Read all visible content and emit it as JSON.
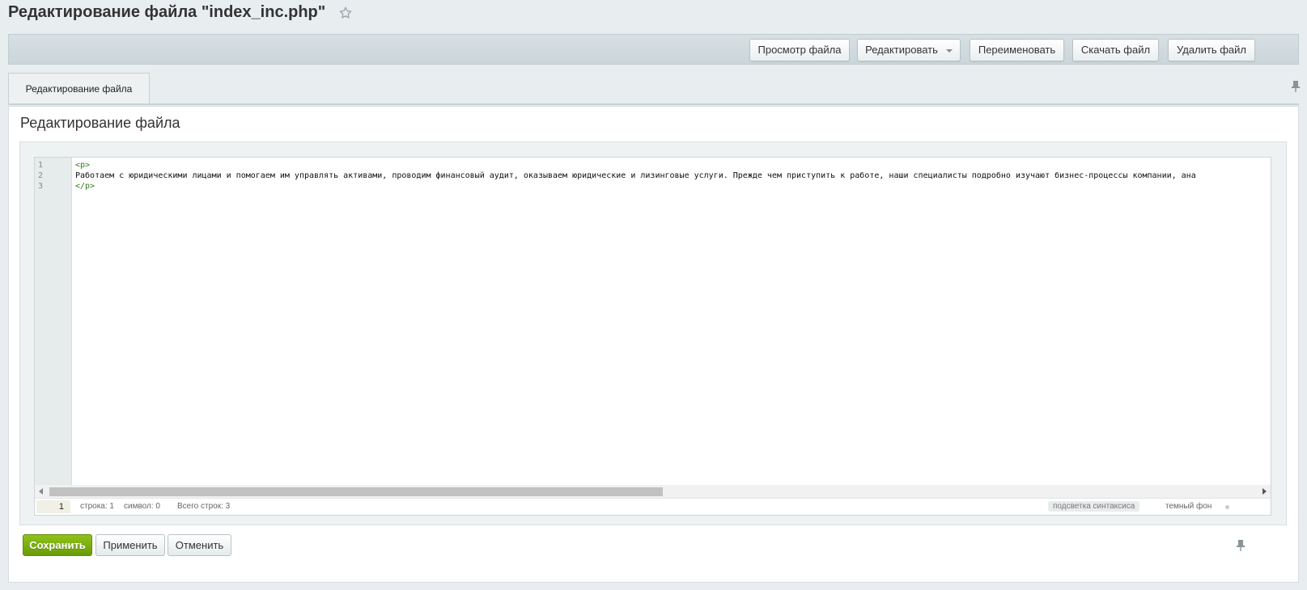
{
  "header": {
    "title": "Редактирование файла \"index_inc.php\""
  },
  "toolbar": {
    "view_label": "Просмотр файла",
    "edit_label": "Редактировать",
    "rename_label": "Переименовать",
    "download_label": "Скачать файл",
    "delete_label": "Удалить файл"
  },
  "tabs": [
    {
      "label": "Редактирование файла"
    }
  ],
  "main": {
    "section_title": "Редактирование файла"
  },
  "editor": {
    "line_numbers": [
      "1",
      "2",
      "3"
    ],
    "lines": [
      "<p>",
      "Работаем с юридическими лицами и помогаем им управлять активами, проводим финансовый аудит, оказываем юридические и лизинговые услуги. Прежде чем приступить к работе, наши специалисты подробно изучают бизнес-процессы компании, ана",
      "</p>"
    ],
    "status": {
      "current_line": "1",
      "line_label": "строка: 1",
      "char_label": "символ: 0",
      "total_label": "Всего строк: 3",
      "highlight_label": "подсветка синтаксиса",
      "dark_label": "темный фон"
    }
  },
  "footer": {
    "save_label": "Сохранить",
    "apply_label": "Применить",
    "cancel_label": "Отменить"
  },
  "colors": {
    "accent_green": "#7aaf0f",
    "tag_green": "#2e7d1e"
  },
  "icons": {
    "favorite": "star-icon",
    "pin": "pin-icon"
  }
}
